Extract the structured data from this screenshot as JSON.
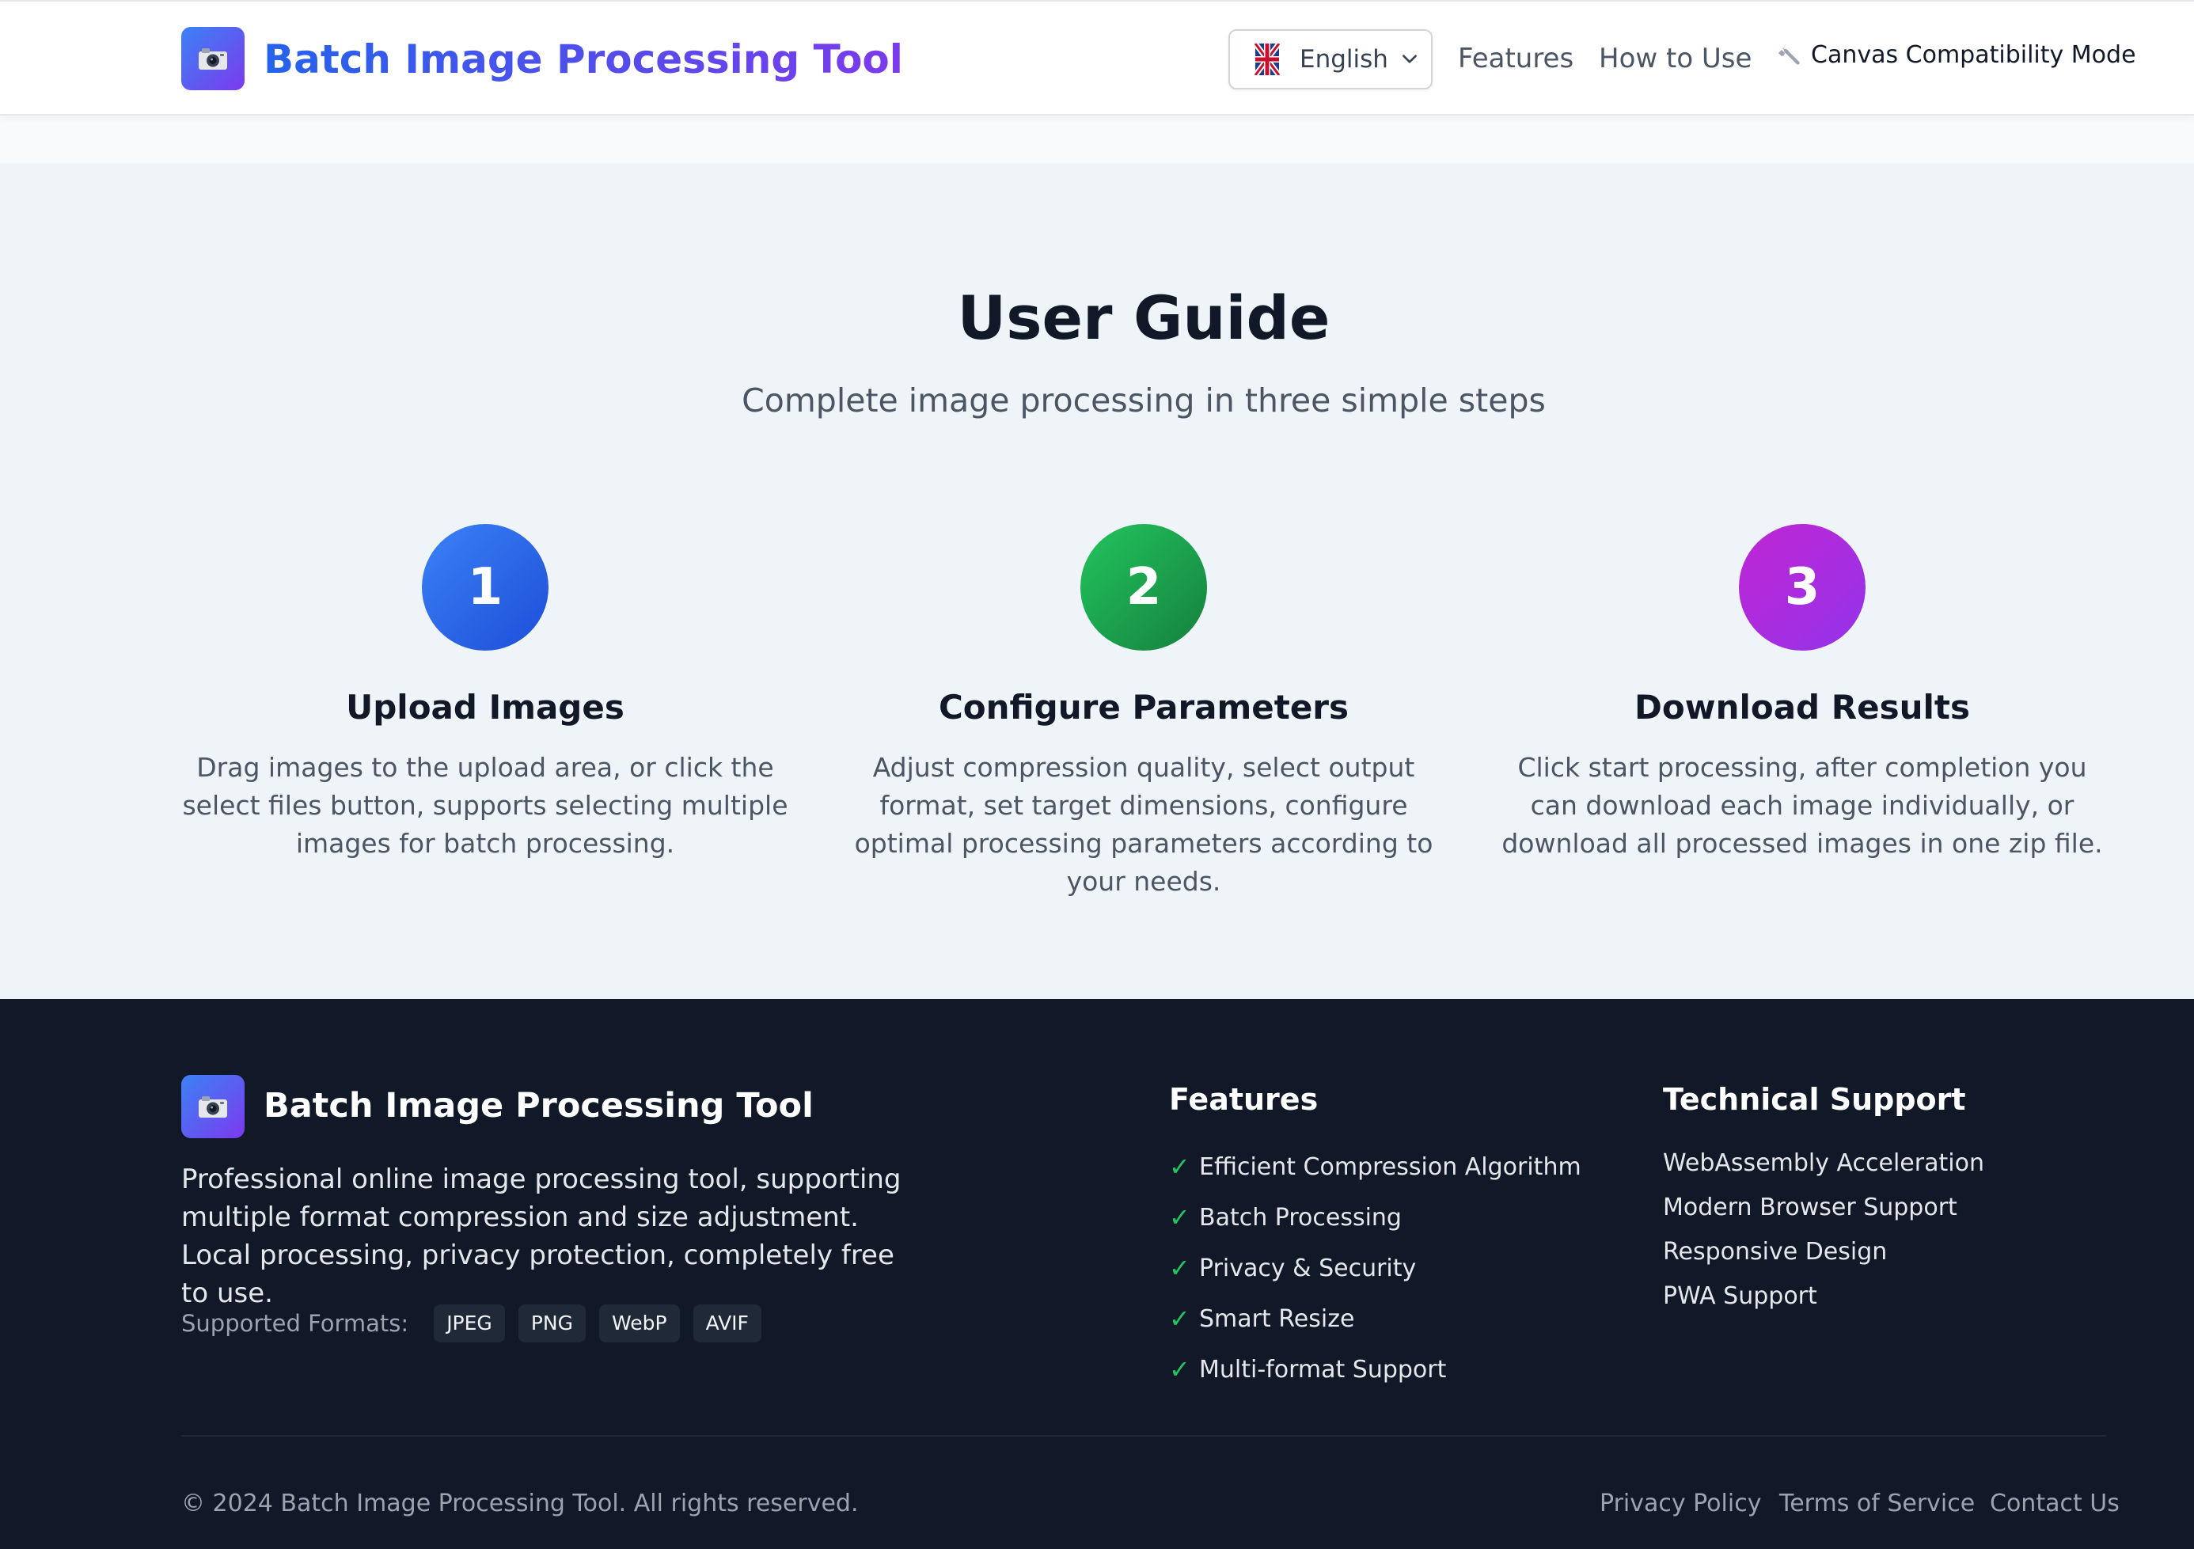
{
  "header": {
    "brand_title": "Batch Image Processing Tool",
    "logo_icon": "camera-icon",
    "language": {
      "selected": "English",
      "flag_icon": "uk-flag-icon"
    },
    "nav": {
      "features": "Features",
      "how_to_use": "How to Use",
      "compat_mode": "Canvas Compatibility Mode",
      "compat_icon": "wrench-icon"
    }
  },
  "guide": {
    "title": "User Guide",
    "subtitle": "Complete image processing in three simple steps",
    "steps": [
      {
        "number": "1",
        "title": "Upload Images",
        "description": "Drag images to the upload area, or click the select files button, supports selecting multiple images for batch processing.",
        "color": "#2563eb"
      },
      {
        "number": "2",
        "title": "Configure Parameters",
        "description": "Adjust compression quality, select output format, set target dimensions, configure optimal processing parameters according to your needs.",
        "color": "#16a34a"
      },
      {
        "number": "3",
        "title": "Download Results",
        "description": "Click start processing, after completion you can download each image individually, or download all processed images in one zip file.",
        "color": "#a21caf"
      }
    ]
  },
  "footer": {
    "brand_title": "Batch Image Processing Tool",
    "description": "Professional online image processing tool, supporting multiple format compression and size adjustment. Local processing, privacy protection, completely free to use.",
    "formats_label": "Supported Formats:",
    "formats": [
      "JPEG",
      "PNG",
      "WebP",
      "AVIF"
    ],
    "features_title": "Features",
    "features": [
      "Efficient Compression Algorithm",
      "Batch Processing",
      "Privacy & Security",
      "Smart Resize",
      "Multi-format Support"
    ],
    "check_mark": "✓",
    "support_title": "Technical Support",
    "support": [
      "WebAssembly Acceleration",
      "Modern Browser Support",
      "Responsive Design",
      "PWA Support"
    ],
    "copyright": "© 2024 Batch Image Processing Tool. All rights reserved.",
    "links": {
      "privacy": "Privacy Policy",
      "terms": "Terms of Service",
      "contact": "Contact Us"
    }
  },
  "colors": {
    "brand_gradient_start": "#2563eb",
    "brand_gradient_end": "#7c3aed",
    "footer_bg": "#111827",
    "guide_bg": "#eff4f9",
    "check_green": "#22c55e"
  }
}
